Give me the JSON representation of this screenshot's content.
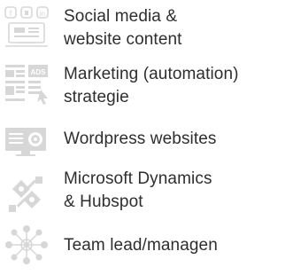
{
  "colors": {
    "icon": "#d7d7d7",
    "text": "#2e2e2e",
    "background": "#ffffff"
  },
  "services": [
    {
      "icon": "social-media-devices-icon",
      "lines": [
        "Social media &",
        "website content"
      ]
    },
    {
      "icon": "marketing-automation-ads-icon",
      "lines": [
        "Marketing (automation)",
        "strategie"
      ]
    },
    {
      "icon": "wordpress-monitor-gear-icon",
      "lines": [
        "Wordpress websites"
      ]
    },
    {
      "icon": "crm-tools-icon",
      "lines": [
        "Microsoft Dynamics",
        "& Hubspot"
      ]
    },
    {
      "icon": "team-network-icon",
      "lines": [
        "Team lead/managen"
      ]
    }
  ]
}
